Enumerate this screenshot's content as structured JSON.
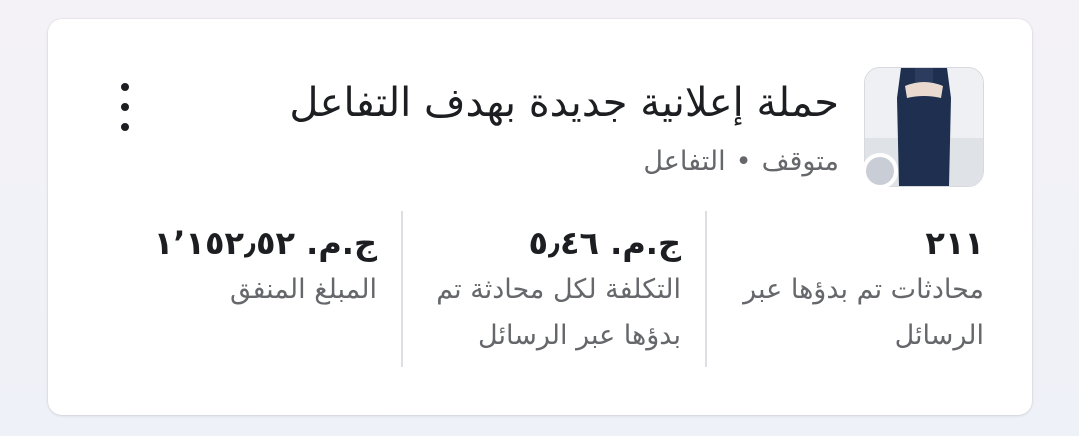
{
  "campaign": {
    "title": "حملة إعلانية جديدة بهدف التفاعل",
    "status": "متوقف",
    "separator": "•",
    "objective": "التفاعل",
    "status_color": "#c9cdd6"
  },
  "actions": {
    "more_icon": "vertical-ellipsis-icon"
  },
  "metrics": [
    {
      "value": "٢١١",
      "label": "محادثات تم بدؤها عبر الرسائل"
    },
    {
      "value": "ج.م. ٥٫٤٦",
      "label": "التكلفة لكل محادثة تم بدؤها عبر الرسائل"
    },
    {
      "value": "ج.م. ١٬١٥٢٫٥٢",
      "label": "المبلغ المنفق"
    }
  ]
}
